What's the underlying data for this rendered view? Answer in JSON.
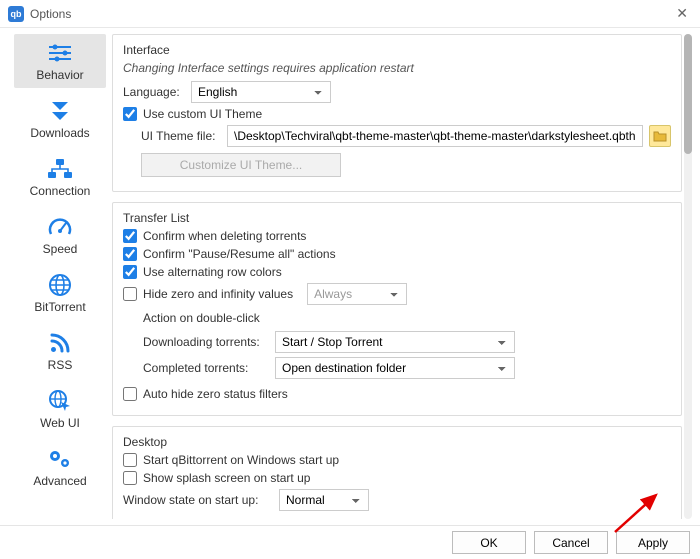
{
  "window": {
    "title": "Options",
    "app_icon_label": "qb"
  },
  "sidebar": {
    "items": [
      {
        "label": "Behavior"
      },
      {
        "label": "Downloads"
      },
      {
        "label": "Connection"
      },
      {
        "label": "Speed"
      },
      {
        "label": "BitTorrent"
      },
      {
        "label": "RSS"
      },
      {
        "label": "Web UI"
      },
      {
        "label": "Advanced"
      }
    ]
  },
  "interface": {
    "title": "Interface",
    "note": "Changing Interface settings requires application restart",
    "language_label": "Language:",
    "language_value": "English",
    "use_custom_theme_label": "Use custom UI Theme",
    "use_custom_theme_checked": true,
    "theme_file_label": "UI Theme file:",
    "theme_file_value": "\\Desktop\\Techviral\\qbt-theme-master\\qbt-theme-master\\darkstylesheet.qbtheme",
    "customize_btn": "Customize UI Theme..."
  },
  "transfer": {
    "title": "Transfer List",
    "confirm_delete_label": "Confirm when deleting torrents",
    "confirm_delete_checked": true,
    "confirm_pause_label": "Confirm \"Pause/Resume all\" actions",
    "confirm_pause_checked": true,
    "alt_rows_label": "Use alternating row colors",
    "alt_rows_checked": true,
    "hide_zero_label": "Hide zero and infinity values",
    "hide_zero_checked": false,
    "hide_zero_mode": "Always",
    "action_title": "Action on double-click",
    "downloading_label": "Downloading torrents:",
    "downloading_value": "Start / Stop Torrent",
    "completed_label": "Completed torrents:",
    "completed_value": "Open destination folder",
    "auto_hide_label": "Auto hide zero status filters",
    "auto_hide_checked": false
  },
  "desktop": {
    "title": "Desktop",
    "start_win_label": "Start qBittorrent on Windows start up",
    "start_win_checked": false,
    "splash_label": "Show splash screen on start up",
    "splash_checked": false,
    "win_state_label": "Window state on start up:",
    "win_state_value": "Normal"
  },
  "footer": {
    "ok": "OK",
    "cancel": "Cancel",
    "apply": "Apply"
  }
}
